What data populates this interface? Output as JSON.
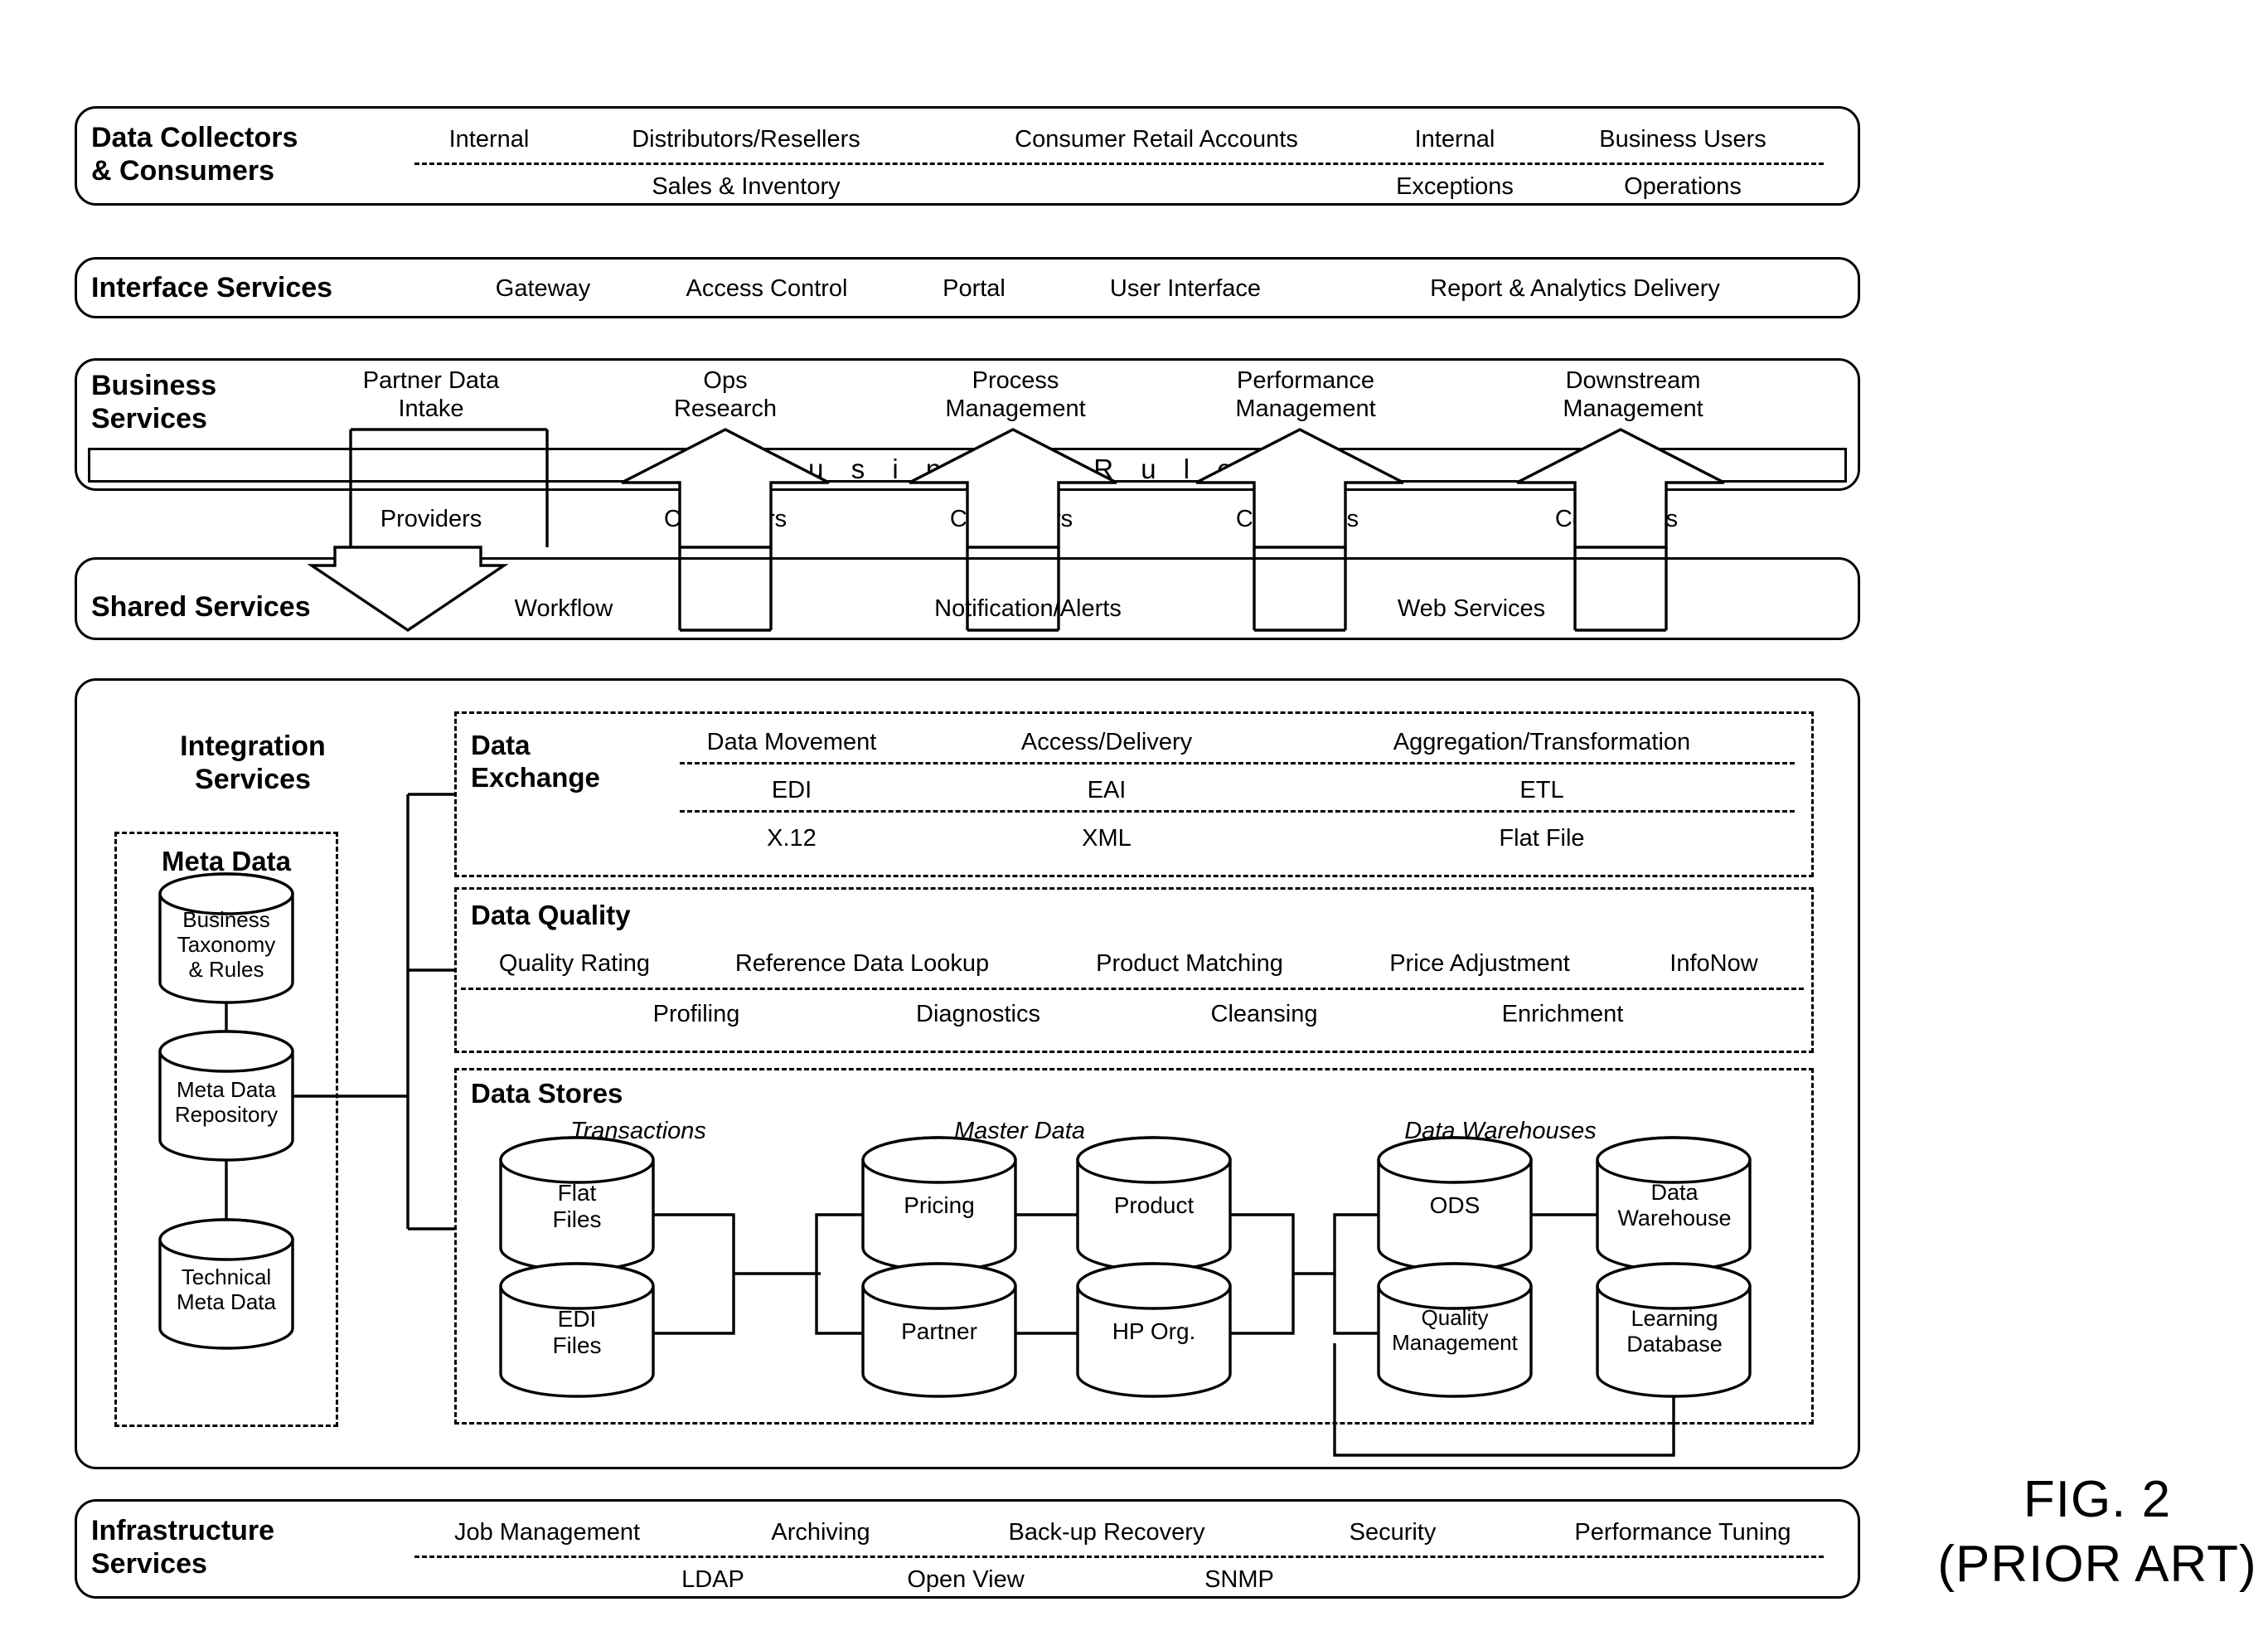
{
  "figure": {
    "caption": "FIG. 2\n(PRIOR ART)"
  },
  "bands": {
    "data_collectors": {
      "title": "Data Collectors\n& Consumers",
      "row1": [
        "Internal",
        "Distributors/Resellers",
        "Consumer Retail Accounts",
        "Internal",
        "Business Users"
      ],
      "row2": [
        "Sales & Inventory",
        "Exceptions",
        "Operations"
      ]
    },
    "interface_services": {
      "title": "Interface Services",
      "items": [
        "Gateway",
        "Access Control",
        "Portal",
        "User Interface",
        "Report & Analytics Delivery"
      ]
    },
    "business_services": {
      "title": "Business\nServices",
      "pillars": [
        "Partner Data\nIntake",
        "Ops\nResearch",
        "Process\nManagement",
        "Performance\nManagement",
        "Downstream\nManagement"
      ],
      "rules_bar": "B u s i n e s s  R u l e s",
      "connector_labels": [
        "Providers",
        "Consumers",
        "Consumers",
        "Consumers",
        "Consumers"
      ]
    },
    "shared_services": {
      "title": "Shared Services",
      "items": [
        "Workflow",
        "Notification/Alerts",
        "Web Services"
      ]
    },
    "integration_services": {
      "title": "Integration\nServices",
      "meta_data": {
        "title": "Meta Data",
        "stores": [
          "Business\nTaxonomy\n& Rules",
          "Meta Data\nRepository",
          "Technical\nMeta Data"
        ]
      },
      "data_exchange": {
        "title": "Data\nExchange",
        "row1": [
          "Data Movement",
          "Access/Delivery",
          "Aggregation/Transformation"
        ],
        "row2": [
          "EDI",
          "EAI",
          "ETL"
        ],
        "row3": [
          "X.12",
          "XML",
          "Flat File"
        ]
      },
      "data_quality": {
        "title": "Data Quality",
        "row1": [
          "Quality Rating",
          "Reference Data Lookup",
          "Product Matching",
          "Price Adjustment",
          "InfoNow"
        ],
        "row2": [
          "Profiling",
          "Diagnostics",
          "Cleansing",
          "Enrichment"
        ]
      },
      "data_stores": {
        "title": "Data Stores",
        "groups": [
          "Transactions",
          "Master Data",
          "Data Warehouses"
        ],
        "cylinders": [
          "Flat\nFiles",
          "EDI\nFiles",
          "Pricing",
          "Partner",
          "Product",
          "HP Org.",
          "ODS",
          "Quality\nManagement",
          "Data\nWarehouse",
          "Learning\nDatabase"
        ]
      }
    },
    "infrastructure_services": {
      "title": "Infrastructure\nServices",
      "row1": [
        "Job Management",
        "Archiving",
        "Back-up Recovery",
        "Security",
        "Performance Tuning"
      ],
      "row2": [
        "LDAP",
        "Open View",
        "SNMP"
      ]
    }
  }
}
